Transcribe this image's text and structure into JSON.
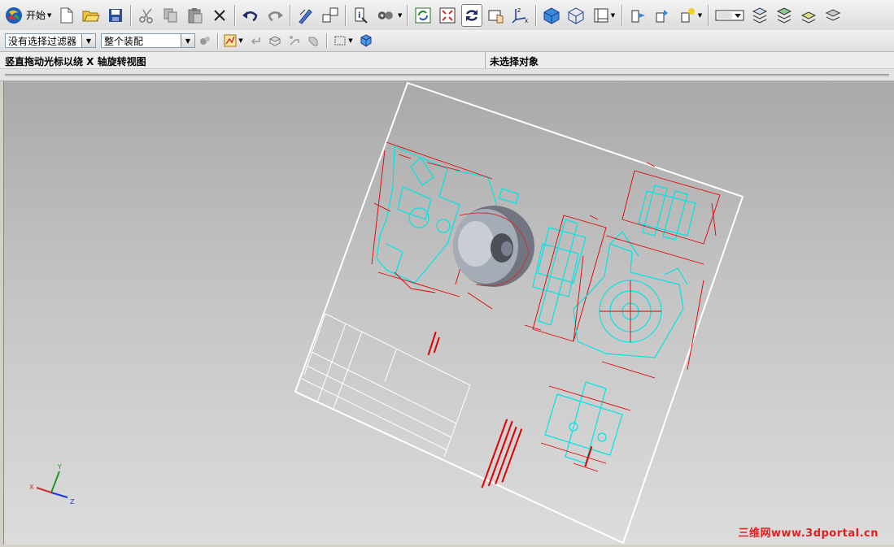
{
  "toolbar": {
    "start_label": "开始"
  },
  "filters": {
    "selection_filter": "没有选择过滤器",
    "scope": "整个装配"
  },
  "status": {
    "prompt": "竖直拖动光标以绕 X 轴旋转视图",
    "selection": "未选择对象"
  },
  "watermark": "三维网www.3dportal.cn",
  "colors": {
    "background_top": "#a9a9a9",
    "background_bottom": "#dcdcdc",
    "drawing_border": "#ffffff",
    "geometry_cyan": "#00e5e5",
    "dimension_red": "#e00000",
    "watermark_red": "#e02020"
  },
  "axis_triad": {
    "x": "X",
    "y": "Y",
    "z": "Z"
  },
  "icons": [
    "start-icon",
    "new-icon",
    "open-icon",
    "save-icon",
    "cut-icon",
    "copy-icon",
    "paste-icon",
    "delete-icon",
    "undo-icon",
    "redo-icon",
    "edit-icon",
    "layout-icon",
    "info-icon",
    "view-icon",
    "refresh-icon",
    "fit-icon",
    "rotate-icon",
    "pan-icon",
    "wcs-icon",
    "shaded-icon",
    "wireframe-icon",
    "drawing-icon",
    "orient-icon",
    "view-up-icon",
    "view-light-icon",
    "display-icon",
    "layer1-icon",
    "layer2-icon",
    "layer3-icon",
    "layer4-icon"
  ]
}
